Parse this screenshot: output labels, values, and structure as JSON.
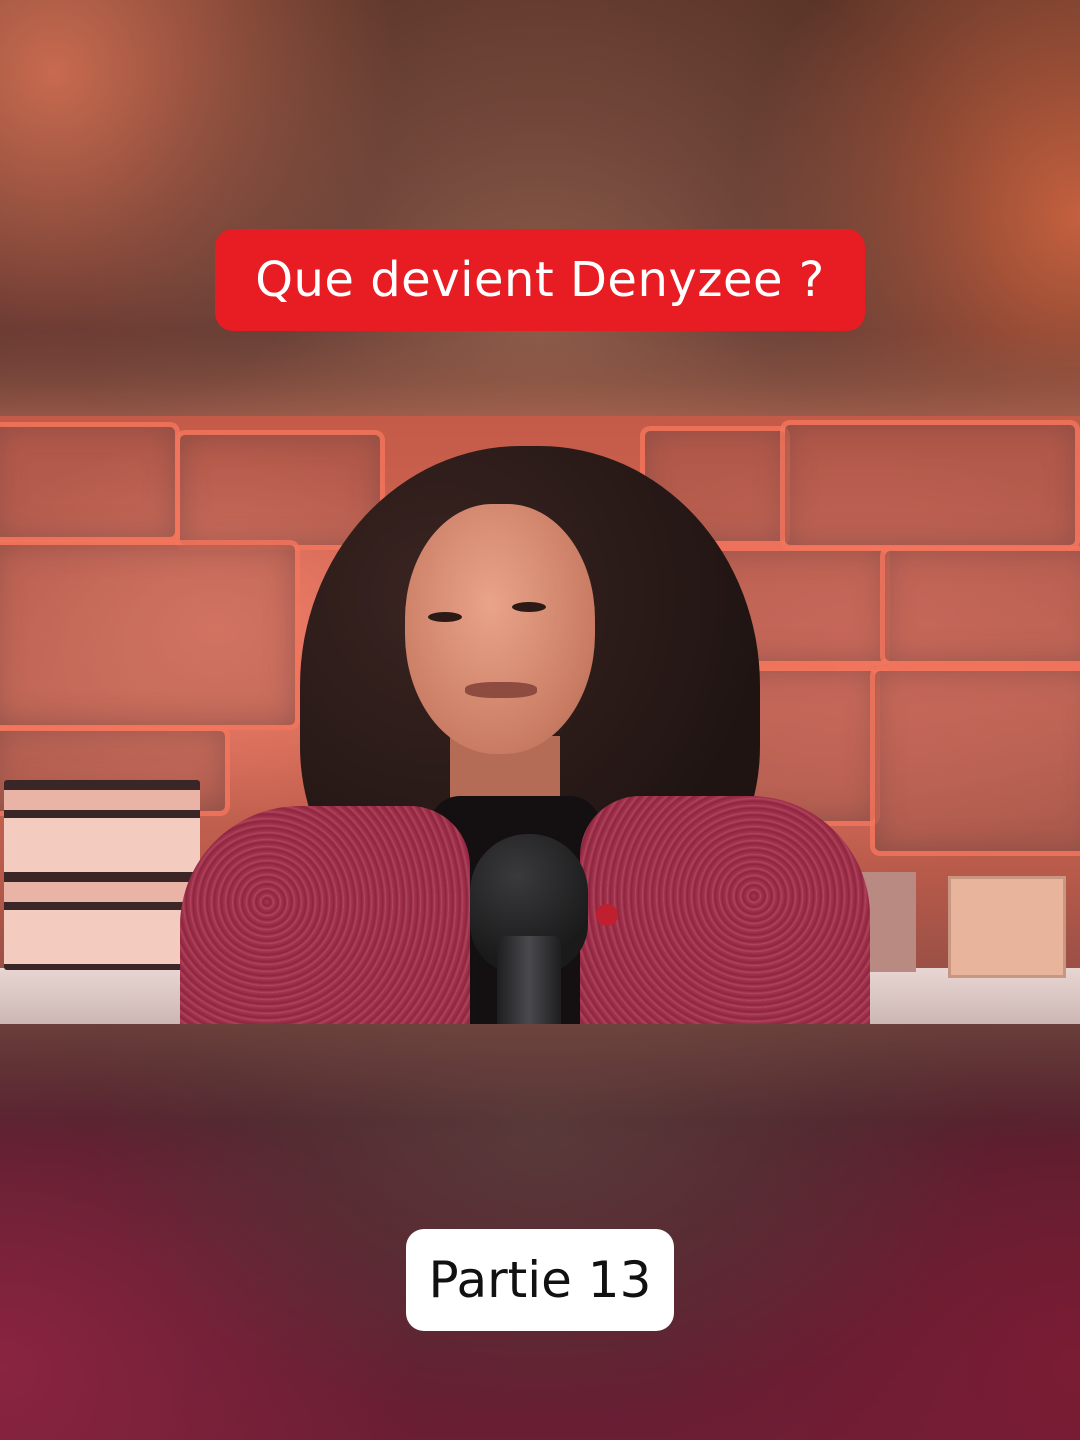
{
  "overlay": {
    "title": "Que devient Denyzee ?",
    "part_label": "Partie 13"
  },
  "colors": {
    "title_pill_bg": "#e81c23",
    "title_text": "#ffffff",
    "part_pill_bg": "#ffffff",
    "part_text": "#111111"
  }
}
